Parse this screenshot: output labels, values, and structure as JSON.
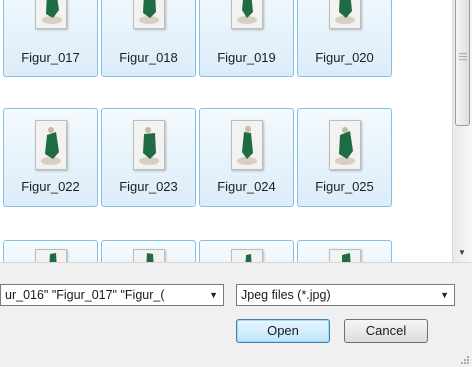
{
  "thumbnails": {
    "row1": [
      "Figur_017",
      "Figur_018",
      "Figur_019",
      "Figur_020"
    ],
    "row2": [
      "Figur_022",
      "Figur_023",
      "Figur_024",
      "Figur_025"
    ]
  },
  "footer": {
    "file_name_value": "ur_016\" \"Figur_017\" \"Figur_(",
    "file_type_value": "Jpeg files (*.jpg)",
    "open_label": "Open",
    "cancel_label": "Cancel"
  },
  "colors": {
    "selection_border": "#84c1ea",
    "selection_fill": "#dcecf9",
    "figurine_green": "#1f6b45"
  },
  "icons": {
    "thumbnail": "figurine-photo-thumbnail",
    "dropdown": "chevron-down-icon",
    "scroll": "scroll-down-arrow-icon"
  }
}
